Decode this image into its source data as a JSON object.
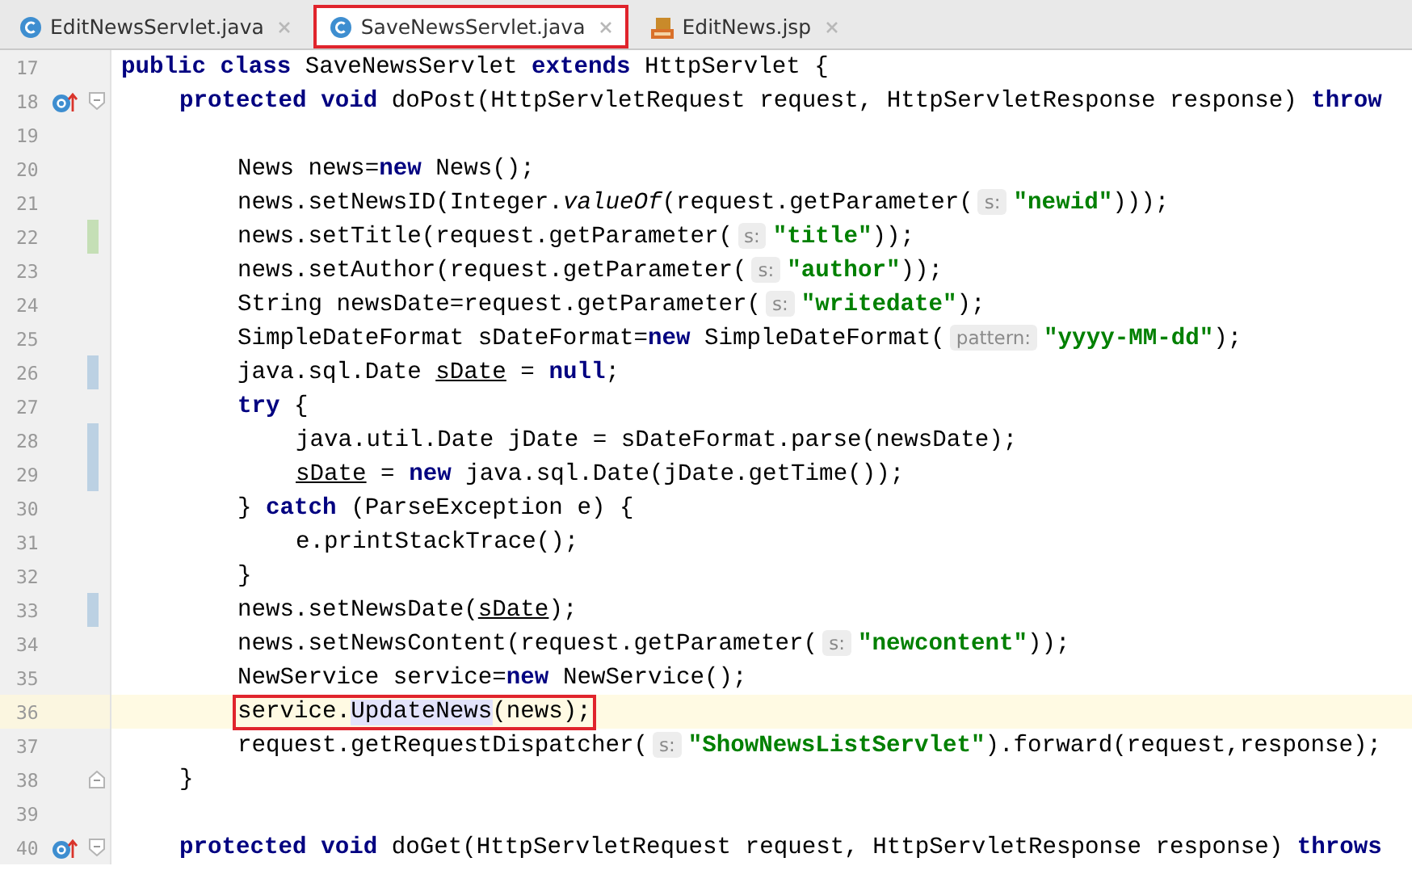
{
  "tabs": [
    {
      "label": "EditNewsServlet.java",
      "kind": "class",
      "selected": false,
      "highlighted": false
    },
    {
      "label": "SaveNewsServlet.java",
      "kind": "class",
      "selected": true,
      "highlighted": true
    },
    {
      "label": "EditNews.jsp",
      "kind": "jsp",
      "selected": false,
      "highlighted": false
    }
  ],
  "editor": {
    "lines": [
      {
        "number": "17",
        "code": [
          {
            "kind": "keyword",
            "text": "public class"
          },
          {
            "text": " SaveNewsServlet "
          },
          {
            "kind": "keyword",
            "text": "extends"
          },
          {
            "text": " HttpServlet {"
          }
        ],
        "children": [
          {
            "number": "18",
            "kind": "override",
            "code": [
              {
                "kind": "keyword",
                "text": "protected void"
              },
              {
                "text": " doPost(HttpServletRequest request, HttpServletResponse response) "
              },
              {
                "kind": "keyword",
                "text": "throw"
              }
            ],
            "children": [
              {
                "number": "19"
              },
              {
                "number": "20",
                "code": [
                  {
                    "text": "News news="
                  },
                  {
                    "kind": "keyword",
                    "text": "new"
                  },
                  {
                    "text": " News();"
                  }
                ]
              },
              {
                "number": "21",
                "code": [
                  {
                    "text": "news.setNewsID(Integer."
                  },
                  {
                    "kind": "italic",
                    "text": "valueOf"
                  },
                  {
                    "text": "(request.getParameter("
                  },
                  {
                    "kind": "hint",
                    "text": "s:"
                  },
                  {
                    "kind": "string",
                    "text": "\"newid\""
                  },
                  {
                    "text": ")));"
                  }
                ]
              },
              {
                "number": "22",
                "kind": "added",
                "code": [
                  {
                    "text": "news.setTitle(request.getParameter("
                  },
                  {
                    "kind": "hint",
                    "text": "s:"
                  },
                  {
                    "kind": "string",
                    "text": "\"title\""
                  },
                  {
                    "text": "));"
                  }
                ]
              },
              {
                "number": "23",
                "code": [
                  {
                    "text": "news.setAuthor(request.getParameter("
                  },
                  {
                    "kind": "hint",
                    "text": "s:"
                  },
                  {
                    "kind": "string",
                    "text": "\"author\""
                  },
                  {
                    "text": "));"
                  }
                ]
              },
              {
                "number": "24",
                "code": [
                  {
                    "text": "String newsDate=request.getParameter("
                  },
                  {
                    "kind": "hint",
                    "text": "s:"
                  },
                  {
                    "kind": "string",
                    "text": "\"writedate\""
                  },
                  {
                    "text": ");"
                  }
                ]
              },
              {
                "number": "25",
                "code": [
                  {
                    "text": "SimpleDateFormat sDateFormat="
                  },
                  {
                    "kind": "keyword",
                    "text": "new"
                  },
                  {
                    "text": " SimpleDateFormat("
                  },
                  {
                    "kind": "hint",
                    "text": "pattern:"
                  },
                  {
                    "kind": "string",
                    "text": "\"yyyy-MM-dd\""
                  },
                  {
                    "text": ");"
                  }
                ]
              },
              {
                "number": "26",
                "kind": "modified",
                "code": [
                  {
                    "text": "java.sql.Date "
                  },
                  {
                    "kind": "underlined",
                    "text": "sDate"
                  },
                  {
                    "text": " = "
                  },
                  {
                    "kind": "keyword",
                    "text": "null"
                  },
                  {
                    "text": ";"
                  }
                ]
              },
              {
                "number": "27",
                "code": [
                  {
                    "kind": "keyword",
                    "text": "try"
                  },
                  {
                    "text": " {"
                  }
                ],
                "children": [
                  {
                    "number": "28",
                    "kind": "modified",
                    "code": [
                      {
                        "text": "java.util.Date jDate = sDateFormat.parse(newsDate);"
                      }
                    ]
                  },
                  {
                    "number": "29",
                    "kind": "modified",
                    "code": [
                      {
                        "kind": "underlined",
                        "text": "sDate"
                      },
                      {
                        "text": " = "
                      },
                      {
                        "kind": "keyword",
                        "text": "new"
                      },
                      {
                        "text": " java.sql.Date(jDate.getTime());"
                      }
                    ]
                  }
                ]
              },
              {
                "number": "30",
                "code": [
                  {
                    "text": "} "
                  },
                  {
                    "kind": "keyword",
                    "text": "catch"
                  },
                  {
                    "text": " (ParseException e) {"
                  }
                ],
                "children": [
                  {
                    "number": "31",
                    "code": [
                      {
                        "text": "e.printStackTrace();"
                      }
                    ]
                  }
                ]
              },
              {
                "number": "32",
                "code": [
                  {
                    "text": "}"
                  }
                ]
              },
              {
                "number": "33",
                "kind": "modified",
                "code": [
                  {
                    "text": "news.setNewsDate("
                  },
                  {
                    "kind": "underlined",
                    "text": "sDate"
                  },
                  {
                    "text": ");"
                  }
                ]
              },
              {
                "number": "34",
                "code": [
                  {
                    "text": "news.setNewsContent(request.getParameter("
                  },
                  {
                    "kind": "hint",
                    "text": "s:"
                  },
                  {
                    "kind": "string",
                    "text": "\"newcontent\""
                  },
                  {
                    "text": "));"
                  }
                ]
              },
              {
                "number": "35",
                "code": [
                  {
                    "text": "NewService service="
                  },
                  {
                    "kind": "keyword",
                    "text": "new"
                  },
                  {
                    "text": " NewService();"
                  }
                ]
              },
              {
                "number": "36",
                "current": true,
                "highlighted": true,
                "code": [
                  {
                    "text": "service."
                  },
                  {
                    "kind": "reference",
                    "text": "UpdateNews"
                  },
                  {
                    "text": "(news);"
                  }
                ]
              },
              {
                "number": "37",
                "code": [
                  {
                    "text": "request.getRequestDispatcher("
                  },
                  {
                    "kind": "hint",
                    "text": "s:"
                  },
                  {
                    "kind": "string",
                    "text": "\"ShowNewsListServlet\""
                  },
                  {
                    "text": ").forward(request,response);"
                  }
                ]
              }
            ]
          },
          {
            "number": "38",
            "kind": "fold_end",
            "code": [
              {
                "text": "}"
              }
            ]
          },
          {
            "number": "39"
          },
          {
            "number": "40",
            "kind": "override",
            "code": [
              {
                "kind": "keyword",
                "text": "protected void"
              },
              {
                "text": " doGet(HttpServletRequest request, HttpServletResponse response) "
              },
              {
                "kind": "keyword",
                "text": "throws"
              }
            ]
          }
        ]
      }
    ]
  }
}
